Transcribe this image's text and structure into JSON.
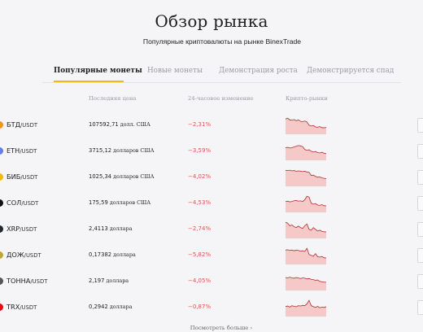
{
  "page": {
    "title": "Обзор рынка",
    "subtitle": "Популярные криптовалюты на рынке BinexTrade"
  },
  "tabs": [
    {
      "label": "Популярные монеты",
      "active": true
    },
    {
      "label": "Новые монеты",
      "active": false
    },
    {
      "label": "Демонстрация роста",
      "active": false
    },
    {
      "label": "Демонстрируется спад",
      "active": false
    }
  ],
  "columns": {
    "name": "",
    "price": "Последняя цена",
    "change": "24-часовое изменение",
    "chart": "Крипто-рынки"
  },
  "colors": {
    "accent": "#f0b90b",
    "negative": "#e05252",
    "spark_fill": "#f6c9c9",
    "spark_line": "#b03030"
  },
  "rows": [
    {
      "base": "БТД",
      "quote": "/USDT",
      "price": "107592,71",
      "unit": "долл. США",
      "change": "−2,31%",
      "icon_color": "#f7931a",
      "icon": "bitcoin-icon",
      "spark": [
        0.85,
        0.9,
        0.8,
        0.78,
        0.82,
        0.75,
        0.8,
        0.72,
        0.7,
        0.74,
        0.68,
        0.5,
        0.45,
        0.48,
        0.4,
        0.38,
        0.42,
        0.36,
        0.35,
        0.37
      ]
    },
    {
      "base": "ETH",
      "quote": "/USDT",
      "price": "3715,12",
      "unit": "долларов США",
      "change": "−3,59%",
      "icon_color": "#627eea",
      "icon": "ethereum-icon",
      "spark": [
        0.7,
        0.72,
        0.68,
        0.7,
        0.74,
        0.78,
        0.82,
        0.8,
        0.76,
        0.6,
        0.55,
        0.58,
        0.5,
        0.45,
        0.48,
        0.42,
        0.4,
        0.44,
        0.38,
        0.36
      ]
    },
    {
      "base": "БИБ",
      "quote": "/USDT",
      "price": "1025,34",
      "unit": "долларов США",
      "change": "−4,02%",
      "icon_color": "#f0b90b",
      "icon": "bnb-icon",
      "spark": [
        0.9,
        0.88,
        0.9,
        0.86,
        0.88,
        0.84,
        0.86,
        0.85,
        0.82,
        0.84,
        0.8,
        0.78,
        0.6,
        0.62,
        0.55,
        0.5,
        0.52,
        0.46,
        0.44,
        0.42
      ]
    },
    {
      "base": "СОЛ",
      "quote": "/USDT",
      "price": "175,59",
      "unit": "долларов США",
      "change": "−4,53%",
      "icon_color": "#111111",
      "icon": "solana-icon",
      "spark": [
        0.6,
        0.62,
        0.58,
        0.6,
        0.64,
        0.66,
        0.62,
        0.64,
        0.6,
        0.7,
        0.9,
        0.85,
        0.5,
        0.45,
        0.48,
        0.4,
        0.38,
        0.42,
        0.36,
        0.35
      ]
    },
    {
      "base": "XRP",
      "quote": "/USDT",
      "price": "2,4113",
      "unit": "доллара",
      "change": "−2,74%",
      "icon_color": "#23292f",
      "icon": "xrp-icon",
      "spark": [
        0.9,
        0.85,
        0.7,
        0.75,
        0.65,
        0.6,
        0.68,
        0.6,
        0.55,
        0.7,
        0.8,
        0.5,
        0.45,
        0.6,
        0.5,
        0.4,
        0.45,
        0.38,
        0.36,
        0.35
      ]
    },
    {
      "base": "ДОЖ",
      "quote": "/USDT",
      "price": "0,17382",
      "unit": "доллара",
      "change": "−5,82%",
      "icon_color": "#c2a633",
      "icon": "dogecoin-icon",
      "spark": [
        0.8,
        0.82,
        0.78,
        0.8,
        0.76,
        0.8,
        0.78,
        0.74,
        0.76,
        0.72,
        0.9,
        0.55,
        0.5,
        0.45,
        0.6,
        0.42,
        0.4,
        0.44,
        0.36,
        0.35
      ]
    },
    {
      "base": "ТОННА",
      "quote": "/USDT",
      "price": "2,197",
      "unit": "доллара",
      "change": "−4,05%",
      "icon_color": "#555555",
      "icon": "toncoin-icon",
      "spark": [
        0.72,
        0.7,
        0.74,
        0.7,
        0.68,
        0.72,
        0.7,
        0.66,
        0.7,
        0.68,
        0.64,
        0.66,
        0.62,
        0.6,
        0.56,
        0.58,
        0.5,
        0.48,
        0.46,
        0.45
      ]
    },
    {
      "base": "TRX",
      "quote": "/USDT",
      "price": "0,2942",
      "unit": "доллара",
      "change": "−0,87%",
      "icon_color": "#e50915",
      "icon": "tron-icon",
      "spark": [
        0.55,
        0.58,
        0.52,
        0.6,
        0.56,
        0.54,
        0.6,
        0.58,
        0.62,
        0.6,
        0.7,
        0.9,
        0.6,
        0.55,
        0.5,
        0.56,
        0.48,
        0.52,
        0.5,
        0.54
      ]
    }
  ],
  "footer": {
    "more_label": "Посмотреть больше ›"
  }
}
